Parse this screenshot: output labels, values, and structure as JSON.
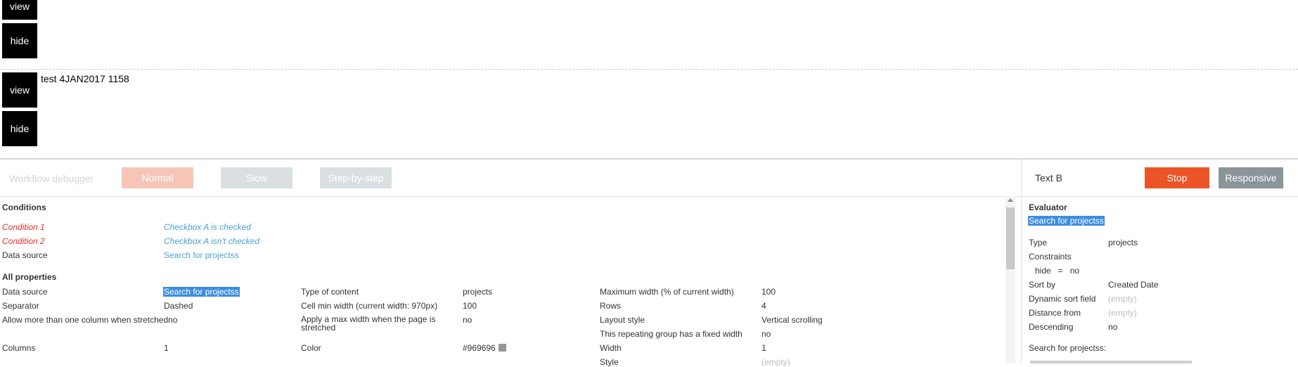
{
  "canvas": {
    "group1": {
      "view_label": "view",
      "hide_label": "hide"
    },
    "group2": {
      "view_label": "view",
      "hide_label": "hide",
      "text": "test 4JAN2017 1158"
    }
  },
  "debugger": {
    "title": "Workflow debugger",
    "speeds": [
      "Normal",
      "Slow",
      "Step-by-step"
    ],
    "speed_colors": {
      "normal": "#f6c5b8",
      "slow": "#dadfe2",
      "step": "#dadfe2"
    },
    "conditions": {
      "title": "Conditions",
      "rows": [
        {
          "label": "Condition 1",
          "value": "Checkbox A is checked"
        },
        {
          "label": "Condition 2",
          "value": "Checkbox A isn't checked"
        },
        {
          "label": "Data source",
          "value": "Search for projectss"
        }
      ]
    },
    "properties": {
      "title": "All properties",
      "col1": [
        {
          "label": "Data source",
          "value": "Search for projectss"
        },
        {
          "label": "Separator",
          "value": "Dashed"
        },
        {
          "label": "Allow more than one column when stretchedno",
          "value": ""
        },
        {
          "label": "Columns",
          "value": "1"
        }
      ],
      "col2": [
        {
          "label": "Type of content",
          "value": "projects"
        },
        {
          "label": "Cell min width (current width: 970px)",
          "value": "100"
        },
        {
          "label": "Apply a max width when the page is stretched",
          "value": "no"
        },
        {
          "label": "Color",
          "value": "#969696"
        }
      ],
      "col3": [
        {
          "label": "Maximum width (% of current width)",
          "value": "100"
        },
        {
          "label": "Rows",
          "value": "4"
        },
        {
          "label": "Layout style",
          "value": "Vertical scrolling"
        },
        {
          "label": "This repeating group has a fixed width",
          "value": "no"
        },
        {
          "label": "Width",
          "value": "1"
        },
        {
          "label": "Style",
          "value": "(empty)"
        }
      ]
    },
    "right": {
      "element": "Text B",
      "stop_label": "Stop",
      "responsive_label": "Responsive",
      "evaluator_title": "Evaluator",
      "search_label": "Search for projectss",
      "rows": [
        {
          "label": "Type",
          "value": "projects"
        },
        {
          "label": "Constraints",
          "value": ""
        },
        {
          "label": "hide   =   no",
          "value": ""
        },
        {
          "label": "Sort by",
          "value": "Created Date"
        },
        {
          "label": "Dynamic sort field",
          "value": "(empty)"
        },
        {
          "label": "Distance from",
          "value": "(empty)"
        },
        {
          "label": "Descending",
          "value": "no"
        }
      ],
      "footer_label": "Search for projectss:"
    }
  }
}
